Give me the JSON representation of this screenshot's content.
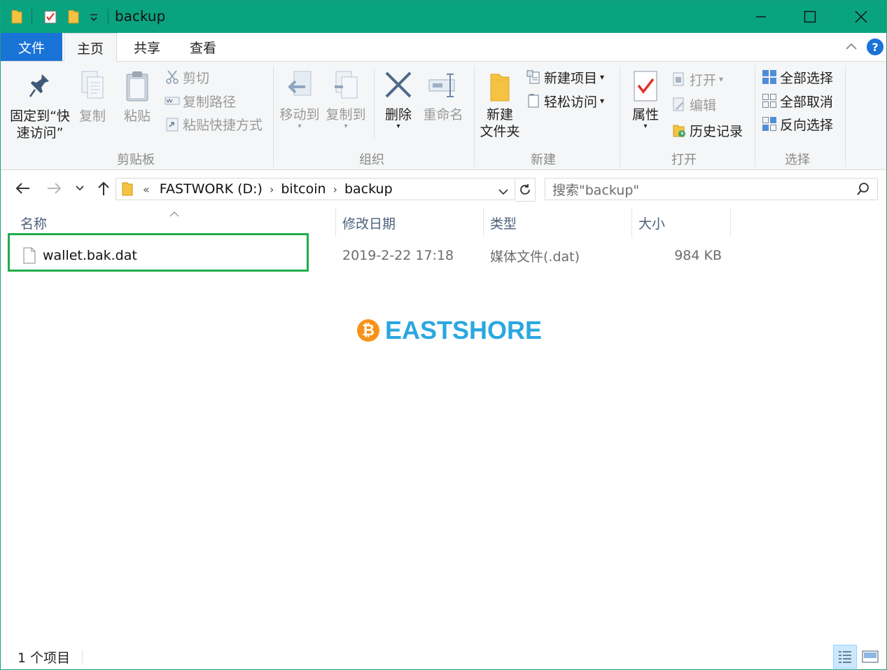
{
  "window": {
    "title": "backup"
  },
  "colors": {
    "titlebar": "#0aa380",
    "file_tab": "#1a73d6",
    "highlight": "#1fae4b",
    "watermark": "#2aa7e0"
  },
  "tabs": [
    {
      "label": "文件"
    },
    {
      "label": "主页"
    },
    {
      "label": "共享"
    },
    {
      "label": "查看"
    }
  ],
  "ribbon": {
    "clipboard": {
      "pin_label_1": "固定到“快",
      "pin_label_2": "速访问”",
      "copy": "复制",
      "paste": "粘贴",
      "cut": "剪切",
      "copy_path": "复制路径",
      "paste_shortcut": "粘贴快捷方式",
      "group": "剪贴板"
    },
    "organize": {
      "move_to": "移动到",
      "copy_to": "复制到",
      "delete": "删除",
      "rename": "重命名",
      "group": "组织"
    },
    "new": {
      "new_folder_1": "新建",
      "new_folder_2": "文件夹",
      "new_item": "新建项目",
      "easy_access": "轻松访问",
      "group": "新建"
    },
    "open": {
      "properties": "属性",
      "open": "打开",
      "edit": "编辑",
      "history": "历史记录",
      "group": "打开"
    },
    "select": {
      "select_all": "全部选择",
      "select_none": "全部取消",
      "invert": "反向选择",
      "group": "选择"
    }
  },
  "address": {
    "overflow": "«",
    "crumbs": [
      "FASTWORK (D:)",
      "bitcoin",
      "backup"
    ],
    "search_placeholder": "搜索\"backup\""
  },
  "columns": {
    "name": "名称",
    "date": "修改日期",
    "type": "类型",
    "size": "大小"
  },
  "files": [
    {
      "name": "wallet.bak.dat",
      "date": "2019-2-22 17:18",
      "type": "媒体文件(.dat)",
      "size": "984 KB"
    }
  ],
  "watermark": {
    "coin": "₿",
    "text": "EASTSHORE"
  },
  "status": {
    "count": "1 个项目"
  }
}
